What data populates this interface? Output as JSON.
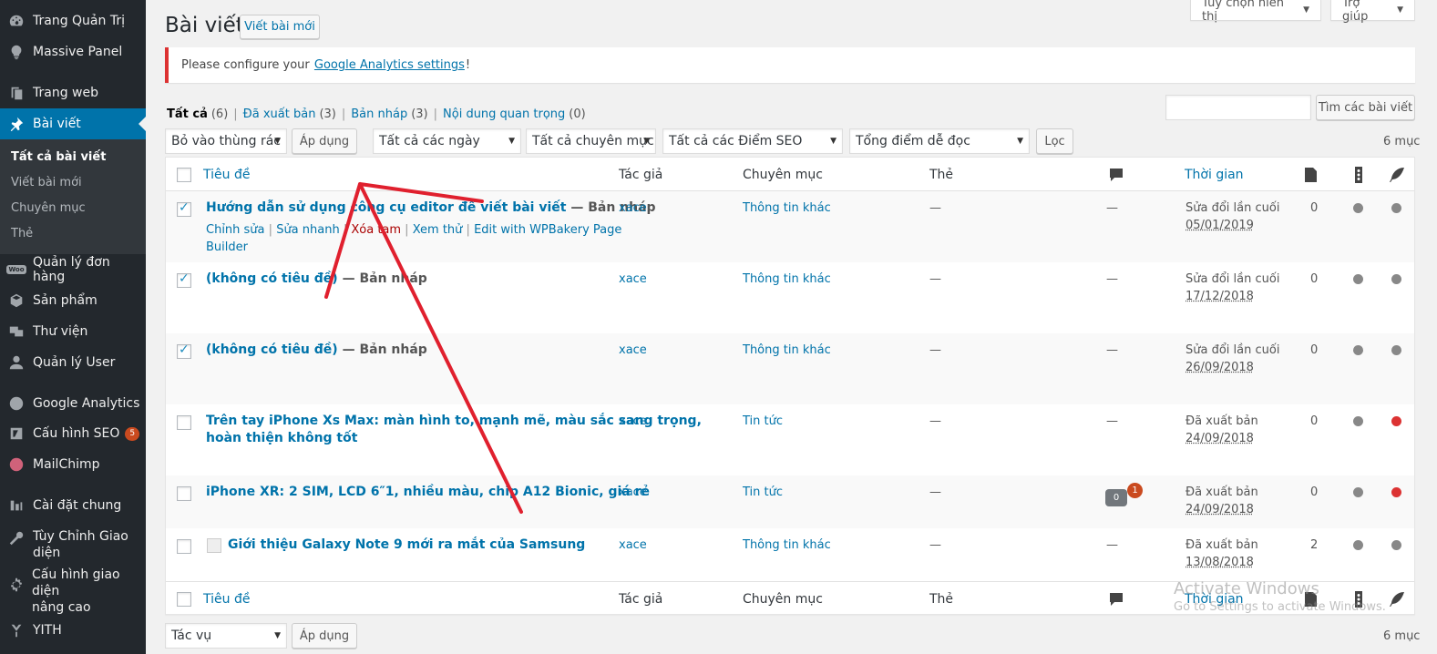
{
  "sidebar": {
    "items": [
      {
        "label": "Trang Quản Trị",
        "icon": "dashboard-icon"
      },
      {
        "label": "Massive Panel",
        "icon": "lightbulb-icon"
      },
      {
        "label": "Trang web",
        "icon": "pages-icon"
      },
      {
        "label": "Bài viết",
        "icon": "pin-icon"
      },
      {
        "label": "Quản lý đơn hàng",
        "icon": "woocommerce-icon",
        "icon_text": "Woo"
      },
      {
        "label": "Sản phẩm",
        "icon": "products-icon"
      },
      {
        "label": "Thư viện",
        "icon": "media-icon"
      },
      {
        "label": "Quản lý User",
        "icon": "user-icon"
      },
      {
        "label": "Google Analytics",
        "icon": "analytics-icon"
      },
      {
        "label": "Cấu hình SEO",
        "icon": "seo-icon",
        "badge": "5"
      },
      {
        "label": "MailChimp",
        "icon": "mailchimp-icon"
      },
      {
        "label": "Cài đặt chung",
        "icon": "settings-icon"
      },
      {
        "label_line1": "Tùy Chỉnh Giao",
        "label_line2": "diện",
        "icon": "tools-icon"
      },
      {
        "label_line1": "Cấu hình giao diện",
        "label_line2": "nâng cao",
        "icon": "gear-icon"
      },
      {
        "label": "YITH",
        "icon": "yith-icon"
      }
    ],
    "submenu": [
      "Tất cả bài viết",
      "Viết bài mới",
      "Chuyên mục",
      "Thẻ"
    ]
  },
  "top": {
    "screen_options": "Tùy chọn hiển thị",
    "help": "Trợ giúp",
    "page_title": "Bài viết",
    "add_new": "Viết bài mới"
  },
  "notice": {
    "before": "Please configure your",
    "link": "Google Analytics settings",
    "after": "!"
  },
  "views": [
    {
      "label": "Tất cả",
      "count": "(6)"
    },
    {
      "label": "Đã xuất bản",
      "count": "(3)"
    },
    {
      "label": "Bản nháp",
      "count": "(3)"
    },
    {
      "label": "Nội dung quan trọng",
      "count": "(0)"
    }
  ],
  "search": {
    "button": "Tìm các bài viết"
  },
  "filters": {
    "bulk_action": "Bỏ vào thùng rác",
    "apply": "Áp dụng",
    "dates": "Tất cả các ngày",
    "categories": "Tất cả chuyên mục",
    "seo": "Tất cả các Điểm SEO",
    "readability": "Tổng điểm dễ đọc",
    "filter": "Lọc",
    "items": "6 mục",
    "bottom_bulk": "Tác vụ"
  },
  "columns": {
    "title": "Tiêu đề",
    "author": "Tác giả",
    "category": "Chuyên mục",
    "tags": "Thẻ",
    "date": "Thời gian"
  },
  "rows": [
    {
      "title": "Hướng dẫn sử dụng công cụ editor để viết bài viết",
      "state": "— Bản nháp",
      "author": "xace",
      "category": "Thông tin khác",
      "tags": "—",
      "comments": "—",
      "date_status": "Sửa đổi lần cuối",
      "date": "05/01/2019",
      "links": "0",
      "checked": true
    },
    {
      "title": "(không có tiêu đề)",
      "state": "— Bản nháp",
      "author": "xace",
      "category": "Thông tin khác",
      "tags": "—",
      "comments": "—",
      "date_status": "Sửa đổi lần cuối",
      "date": "17/12/2018",
      "links": "0",
      "checked": true
    },
    {
      "title": "(không có tiêu đề)",
      "state": "— Bản nháp",
      "author": "xace",
      "category": "Thông tin khác",
      "tags": "—",
      "comments": "—",
      "date_status": "Sửa đổi lần cuối",
      "date": "26/09/2018",
      "links": "0",
      "checked": true
    },
    {
      "title_line1": "Trên tay iPhone Xs Max: màn hình to, mạnh mẽ, màu sắc sang trọng,",
      "title_line2": "hoàn thiện không tốt",
      "author": "xace",
      "category": "Tin tức",
      "tags": "—",
      "comments": "—",
      "date_status": "Đã xuất bản",
      "date": "24/09/2018",
      "links": "0",
      "checked": false
    },
    {
      "title": "iPhone XR: 2 SIM, LCD 6″1, nhiều màu, chip A12 Bionic, giá rẻ",
      "author": "xace",
      "category": "Tin tức",
      "tags": "—",
      "comment_count": "0",
      "pending_count": "1",
      "date_status": "Đã xuất bản",
      "date": "24/09/2018",
      "links": "0",
      "checked": false
    },
    {
      "title": "Giới thiệu Galaxy Note 9 mới ra mắt của Samsung",
      "author": "xace",
      "category": "Thông tin khác",
      "tags": "—",
      "comments": "—",
      "date_status": "Đã xuất bản",
      "date": "13/08/2018",
      "links": "2",
      "checked": false
    }
  ],
  "row_actions": {
    "edit": "Chỉnh sửa",
    "quick_edit": "Sửa nhanh",
    "trash": "Xóa tạm",
    "preview": "Xem thử",
    "wpbakery_line1": "Edit with WPBakery Page",
    "wpbakery_line2": "Builder"
  },
  "watermark": {
    "line1": "Activate Windows",
    "line2": "Go to Settings to activate Windows."
  },
  "colors": {
    "sidebar": "#23282d",
    "active": "#0073aa",
    "link": "#0073aa",
    "notice_error": "#dc3232",
    "seo_bad": "#dc3232",
    "seo_none": "#888888",
    "annotation_arrow": "#e0202e"
  }
}
